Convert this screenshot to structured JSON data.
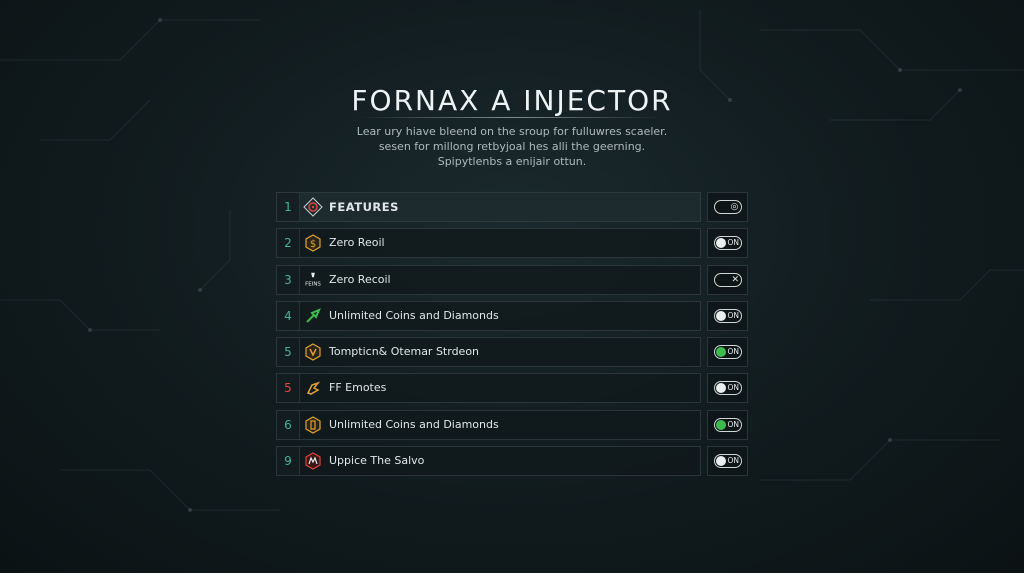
{
  "title": "FORNAX A INJECTOR",
  "subtitle": [
    "Lear ury hiave bleend on the sroup for fulluwres scaeler.",
    "sesen for millong retbyjoal hes alli the geerning.",
    "Spipytlenbs a enijair ottun."
  ],
  "rows": [
    {
      "index": "1",
      "icon": "crosshair-icon",
      "label": "FEATURES",
      "toggle_text": "◎",
      "toggle_state": "header",
      "index_color": "#3fb39a",
      "icon_color": "#d9463c"
    },
    {
      "index": "2",
      "icon": "dollar-shield-icon",
      "label": "Zero Reoil",
      "toggle_text": "ON",
      "toggle_state": "on",
      "index_color": "#3fb39a",
      "icon_color": "#e0a132"
    },
    {
      "index": "3",
      "icon": "feins-logo-icon",
      "icon_text": "FEINS",
      "label": "Zero Recoil",
      "toggle_text": "✕",
      "toggle_state": "off",
      "index_color": "#3fb39a",
      "icon_color": "#e6ecee"
    },
    {
      "index": "4",
      "icon": "green-arrow-icon",
      "label": "Unlimited Coins and Diamonds",
      "toggle_text": "ON",
      "toggle_state": "on",
      "index_color": "#3fb39a",
      "icon_color": "#3dbb4f"
    },
    {
      "index": "5",
      "icon": "gold-shield-icon",
      "label": "Tompticn& Otemar Strdeon",
      "toggle_text": "ON",
      "toggle_state": "on-green",
      "index_color": "#3fb39a",
      "icon_color": "#e0a132"
    },
    {
      "index": "5",
      "icon": "emote-hand-icon",
      "label": "FF Emotes",
      "toggle_text": "ON",
      "toggle_state": "on",
      "index_color": "#e0463d",
      "icon_color": "#e0a132"
    },
    {
      "index": "6",
      "icon": "gold-badge-icon",
      "label": "Unlimited Coins and Diamonds",
      "toggle_text": "ON",
      "toggle_state": "on-green",
      "index_color": "#3fb39a",
      "icon_color": "#e0a132"
    },
    {
      "index": "9",
      "icon": "red-emblem-icon",
      "label": "Uppice The Salvo",
      "toggle_text": "ON",
      "toggle_state": "on",
      "index_color": "#3fb39a",
      "icon_color": "#d9463c"
    }
  ]
}
